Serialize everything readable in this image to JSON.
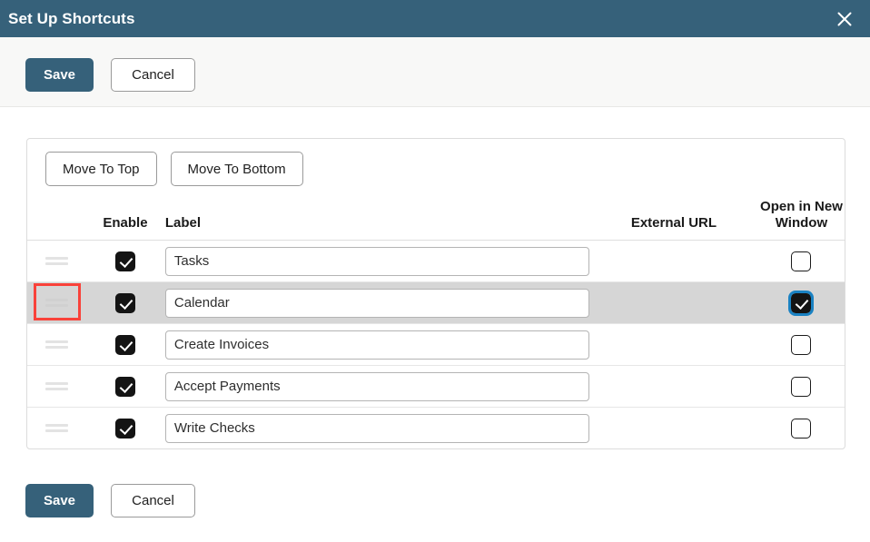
{
  "window": {
    "title": "Set Up Shortcuts",
    "close_icon": "close-icon",
    "header_color": "#36617a"
  },
  "top_actions": {
    "save_label": "Save",
    "cancel_label": "Cancel"
  },
  "bottom_actions": {
    "save_label": "Save",
    "cancel_label": "Cancel"
  },
  "panel": {
    "move_to_top_label": "Move To Top",
    "move_to_bottom_label": "Move To Bottom",
    "columns": {
      "handle": "",
      "enable": "Enable",
      "label": "Label",
      "external_url": "External URL",
      "open_in_new_window": "Open in New Window"
    },
    "rows": [
      {
        "handle_icon": "drag-handle-icon",
        "enabled": true,
        "label": "Tasks",
        "external_url": "",
        "open_in_new_window": false,
        "selected": false,
        "focused_handle": false,
        "focused_new_window": false
      },
      {
        "handle_icon": "drag-handle-icon",
        "enabled": true,
        "label": "Calendar",
        "external_url": "",
        "open_in_new_window": true,
        "selected": true,
        "focused_handle": true,
        "focused_new_window": true
      },
      {
        "handle_icon": "drag-handle-icon",
        "enabled": true,
        "label": "Create Invoices",
        "external_url": "",
        "open_in_new_window": false,
        "selected": false,
        "focused_handle": false,
        "focused_new_window": false
      },
      {
        "handle_icon": "drag-handle-icon",
        "enabled": true,
        "label": "Accept Payments",
        "external_url": "",
        "open_in_new_window": false,
        "selected": false,
        "focused_handle": false,
        "focused_new_window": false
      },
      {
        "handle_icon": "drag-handle-icon",
        "enabled": true,
        "label": "Write Checks",
        "external_url": "",
        "open_in_new_window": false,
        "selected": false,
        "focused_handle": false,
        "focused_new_window": false
      }
    ]
  },
  "colors": {
    "accent": "#36617a",
    "selected_row": "#d6d6d6",
    "focus_ring": "#1a82c3",
    "annotation": "#f9423a"
  }
}
